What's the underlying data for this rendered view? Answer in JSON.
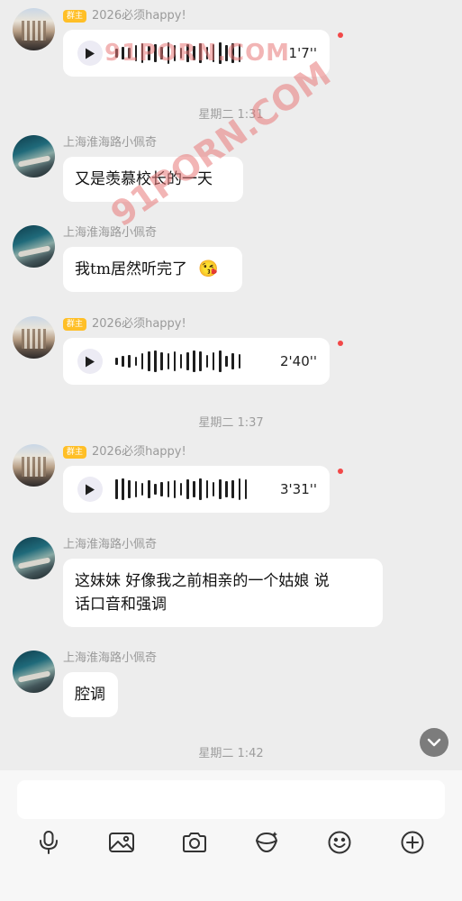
{
  "messages": [
    {
      "sender": "2026必须happy!",
      "badge": "群主",
      "voice_duration": "1'7''"
    },
    {
      "timestamp": "星期二 1:31"
    },
    {
      "sender": "上海淮海路小佩奇",
      "text": "又是羡慕校长的一天"
    },
    {
      "sender": "上海淮海路小佩奇",
      "text": "我tm居然听完了",
      "emoji": "😘"
    },
    {
      "sender": "2026必须happy!",
      "badge": "群主",
      "voice_duration": "2'40''"
    },
    {
      "timestamp": "星期二 1:37"
    },
    {
      "sender": "2026必须happy!",
      "badge": "群主",
      "voice_duration": "3'31''"
    },
    {
      "sender": "上海淮海路小佩奇",
      "text_line1": "这妹妹 好像我之前相亲的一个姑娘 说",
      "text_line2": "话口音和强调"
    },
    {
      "sender": "上海淮海路小佩奇",
      "text": "腔调"
    },
    {
      "timestamp": "星期二 1:42"
    }
  ],
  "watermarks": [
    "91PORN.COM",
    "91PORN.COM"
  ],
  "colors": {
    "background": "#ededed",
    "bubble": "#ffffff",
    "badge": "#ffbf27",
    "unread_dot": "#f24848"
  },
  "toolbar_icons": [
    "microphone-icon",
    "image-icon",
    "camera-icon",
    "red-packet-icon",
    "emoji-icon",
    "plus-icon"
  ]
}
